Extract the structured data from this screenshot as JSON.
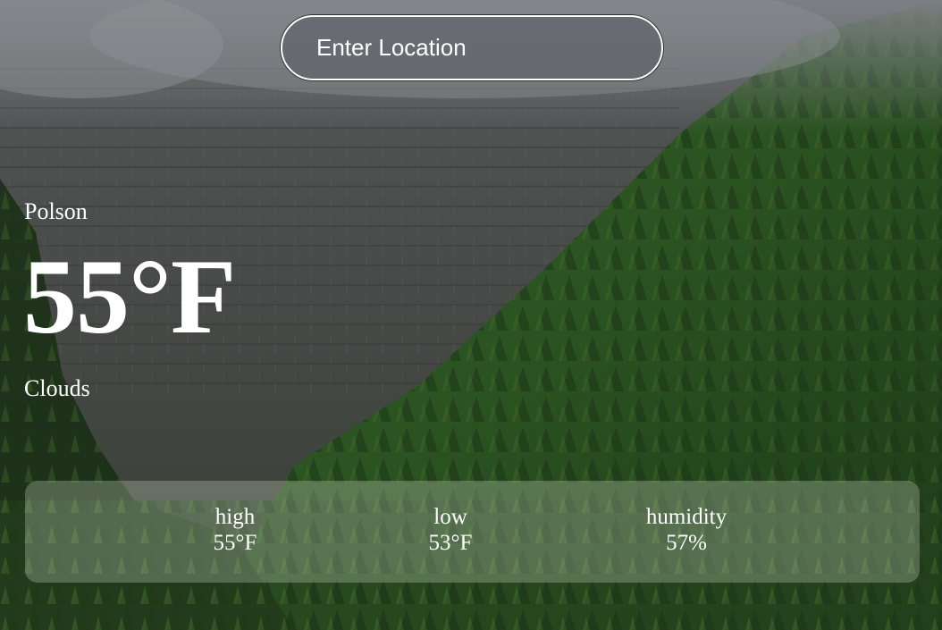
{
  "search": {
    "placeholder": "Enter Location"
  },
  "current": {
    "city": "Polson",
    "temperature": "55°F",
    "condition": "Clouds"
  },
  "stats": {
    "high_label": "high",
    "high_value": "55°F",
    "low_label": "low",
    "low_value": "53°F",
    "humidity_label": "humidity",
    "humidity_value": "57%"
  },
  "colors": {
    "text": "#ffffff",
    "panel": "rgba(215,225,210,0.28)",
    "input_bg": "rgba(95,98,106,0.72)"
  },
  "background": {
    "depicts": "misty-mountain-forest"
  }
}
